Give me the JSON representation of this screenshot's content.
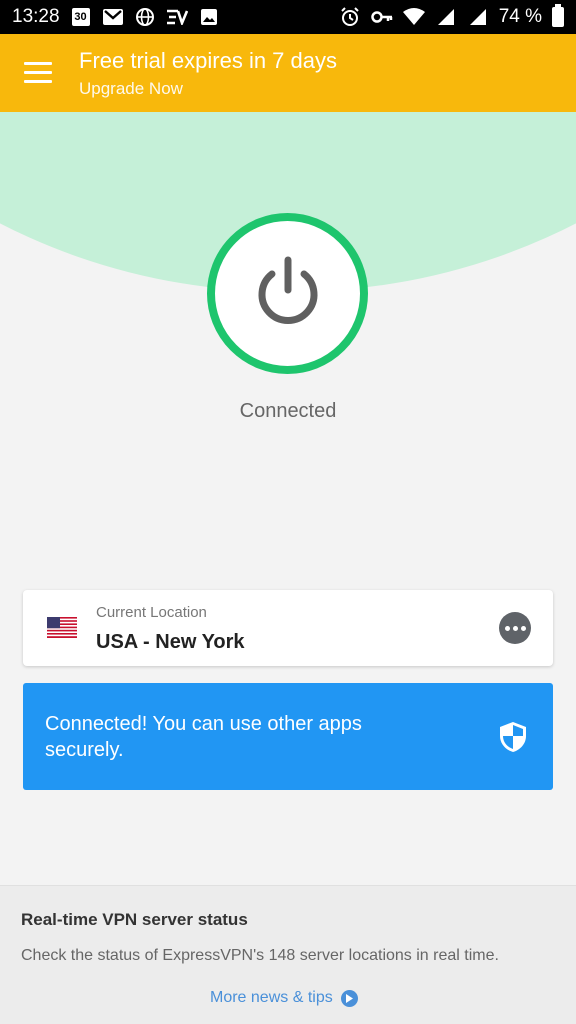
{
  "status_bar": {
    "time": "13:28",
    "calendar_day": "30",
    "battery": "74 %"
  },
  "trial": {
    "title": "Free trial expires in 7 days",
    "subtitle": "Upgrade Now"
  },
  "vpn": {
    "status": "Connected"
  },
  "location": {
    "label": "Current Location",
    "value": "USA - New York"
  },
  "banner": {
    "text": "Connected! You can use other apps securely."
  },
  "news": {
    "title": "Real-time VPN server status",
    "description": "Check the status of ExpressVPN's 148 server locations in real time.",
    "link": "More news & tips"
  },
  "colors": {
    "trial_bar": "#f8b80c",
    "mint": "#c5f0d8",
    "power_ring": "#1ec56d",
    "banner": "#2196f3",
    "link": "#4a90d9"
  }
}
